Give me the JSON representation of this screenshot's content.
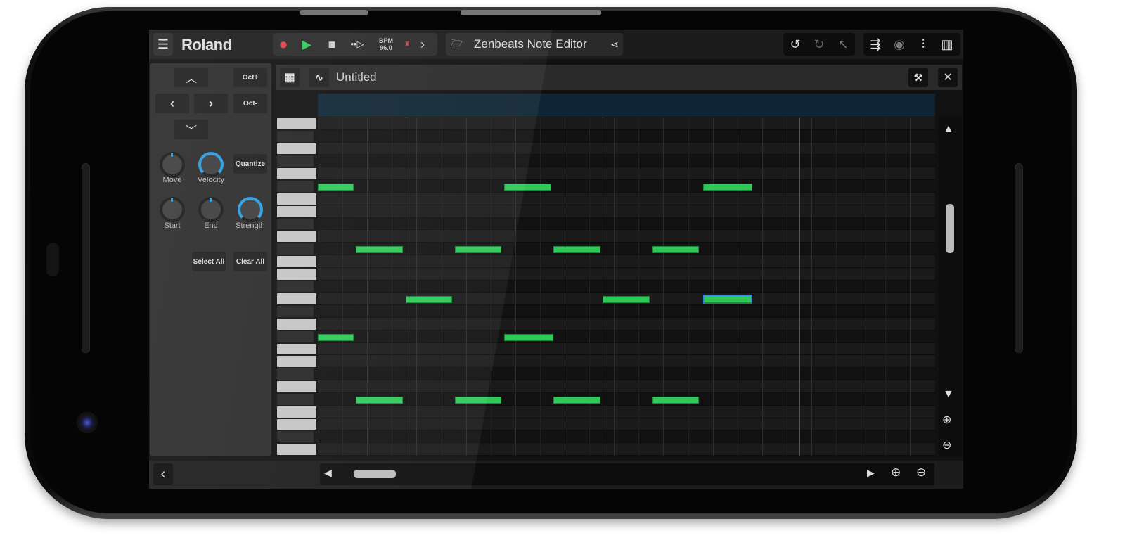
{
  "topbar": {
    "brand": "Roland",
    "bpm_label": "BPM",
    "bpm_value": "96.0",
    "project_title": "Zenbeats Note Editor"
  },
  "editor": {
    "title": "Untitled"
  },
  "left_panel": {
    "oct_up": "Oct+",
    "oct_down": "Oct-",
    "quantize": "Quantize",
    "select_all": "Select All",
    "clear_all": "Clear All",
    "knobs": [
      {
        "label": "Move",
        "active": false
      },
      {
        "label": "Velocity",
        "active": true
      },
      {
        "label": "Start",
        "active": false
      },
      {
        "label": "End",
        "active": false
      },
      {
        "label": "Strength",
        "active": true
      }
    ]
  },
  "colors": {
    "note": "#2fc95a",
    "selected_border": "#2a8fe0",
    "record": "#e0404a",
    "play": "#2fc95a",
    "knob_accent": "#2a9be0"
  },
  "piano_roll": {
    "white_key_rows": [
      0,
      2,
      4,
      6,
      7,
      9,
      11,
      12,
      14,
      16,
      18,
      19,
      21,
      23,
      24,
      26
    ],
    "notes": [
      {
        "row": 5,
        "start": 0,
        "length": 1.45
      },
      {
        "row": 5,
        "start": 7.55,
        "length": 1.9
      },
      {
        "row": 5,
        "start": 15.6,
        "length": 2
      },
      {
        "row": 10,
        "start": 1.55,
        "length": 1.9
      },
      {
        "row": 10,
        "start": 5.55,
        "length": 1.9
      },
      {
        "row": 10,
        "start": 9.55,
        "length": 1.9
      },
      {
        "row": 10,
        "start": 13.55,
        "length": 1.9
      },
      {
        "row": 14,
        "start": 3.55,
        "length": 1.9
      },
      {
        "row": 14,
        "start": 11.55,
        "length": 1.9
      },
      {
        "row": 14,
        "start": 15.6,
        "length": 2,
        "selected": true
      },
      {
        "row": 17,
        "start": 0,
        "length": 1.45
      },
      {
        "row": 17,
        "start": 7.55,
        "length": 2
      },
      {
        "row": 22,
        "start": 1.55,
        "length": 1.9
      },
      {
        "row": 22,
        "start": 5.55,
        "length": 1.9
      },
      {
        "row": 22,
        "start": 9.55,
        "length": 1.9
      },
      {
        "row": 22,
        "start": 13.55,
        "length": 1.9
      }
    ]
  }
}
